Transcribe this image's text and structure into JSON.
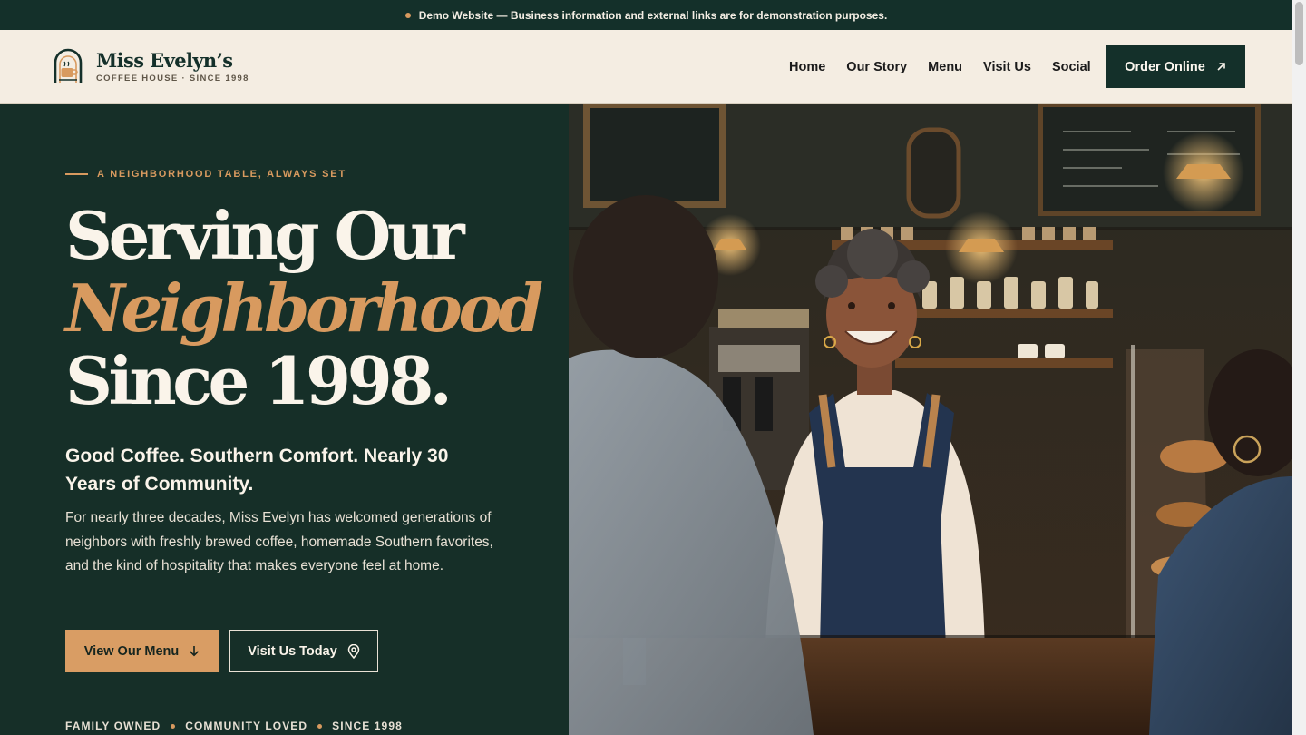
{
  "announcement": {
    "text": "Demo Website — Business information and external links are for demonstration purposes."
  },
  "brand": {
    "name": "Miss Evelyn’s",
    "tagline": "COFFEE HOUSE · SINCE 1998"
  },
  "nav": {
    "items": [
      {
        "label": "Home"
      },
      {
        "label": "Our Story"
      },
      {
        "label": "Menu"
      },
      {
        "label": "Visit Us"
      },
      {
        "label": "Social"
      }
    ],
    "cta_label": "Order Online"
  },
  "hero": {
    "eyebrow": "A NEIGHBORHOOD TABLE, ALWAYS SET",
    "headline_line1": "Serving Our",
    "headline_line2": "Neighborhood",
    "headline_line3": "Since 1998.",
    "subhead": "Good Coffee. Southern Comfort. Nearly 30 Years of Community.",
    "body": "For nearly three decades, Miss Evelyn has welcomed generations of neighbors with freshly brewed coffee, homemade Southern favorites, and the kind of hospitality that makes everyone feel at home.",
    "primary_button": "View Our Menu",
    "secondary_button": "Visit Us Today",
    "badges": [
      "FAMILY OWNED",
      "COMMUNITY LOVED",
      "SINCE 1998"
    ]
  },
  "colors": {
    "forest": "#14302a",
    "cream": "#f4ede2",
    "copper": "#d89a5f"
  },
  "icons": {
    "announce": "dot-icon",
    "logo": "coffee-cup-logo-icon",
    "order": "arrow-up-right-icon",
    "menu_button": "arrow-down-icon",
    "visit_button": "map-pin-icon"
  }
}
